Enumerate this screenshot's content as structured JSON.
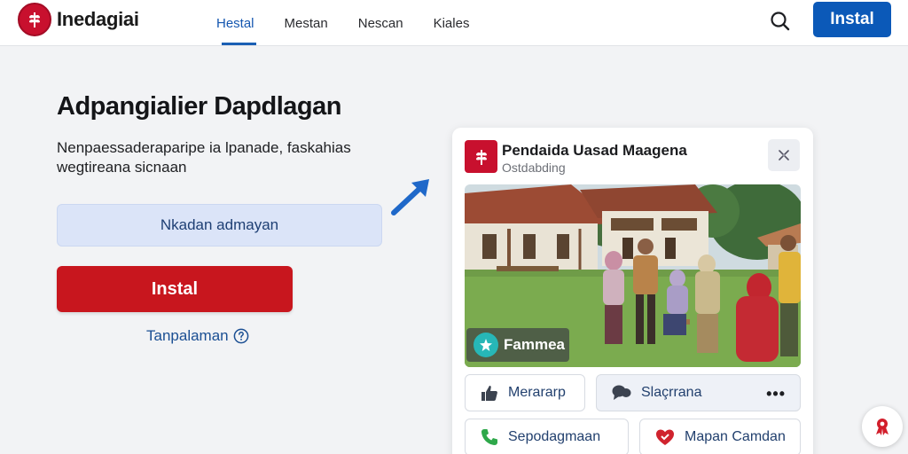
{
  "header": {
    "brand": "Inedagiai",
    "nav": [
      "Hestal",
      "Mestan",
      "Nescan",
      "Kiales"
    ],
    "active_nav": "Hestal",
    "install_label": "Instal"
  },
  "promo": {
    "title": "Adpangialier Dapdlagan",
    "description": "Nenpaessaderaparipe ia lpanade, faskahias wegtireana sicnaan",
    "secondary_label": "Nkadan admayan",
    "primary_label": "Instal",
    "help_label": "Tanpalaman"
  },
  "card": {
    "title": "Pendaida Uasad Maagena",
    "subtitle": "Ostdabding",
    "photo_badge": "Fammea",
    "actions": [
      "Merararp",
      "Slaçrrana",
      "Sepodagmaan",
      "Mapan Camdan"
    ]
  },
  "colors": {
    "brand_red": "#c8102e",
    "primary_button": "#c8161e",
    "header_install": "#0b59b8",
    "nav_active": "#1557b0"
  },
  "icons": {
    "brand": "wheat-logo-icon",
    "search": "search-icon",
    "help": "help-circle-icon",
    "card_menu": "expand-icon",
    "badge": "star-icon",
    "actions": [
      "thumbs-up-icon",
      "chat-bubble-icon",
      "phone-icon",
      "heart-icon"
    ],
    "fab": "ribbon-icon"
  }
}
